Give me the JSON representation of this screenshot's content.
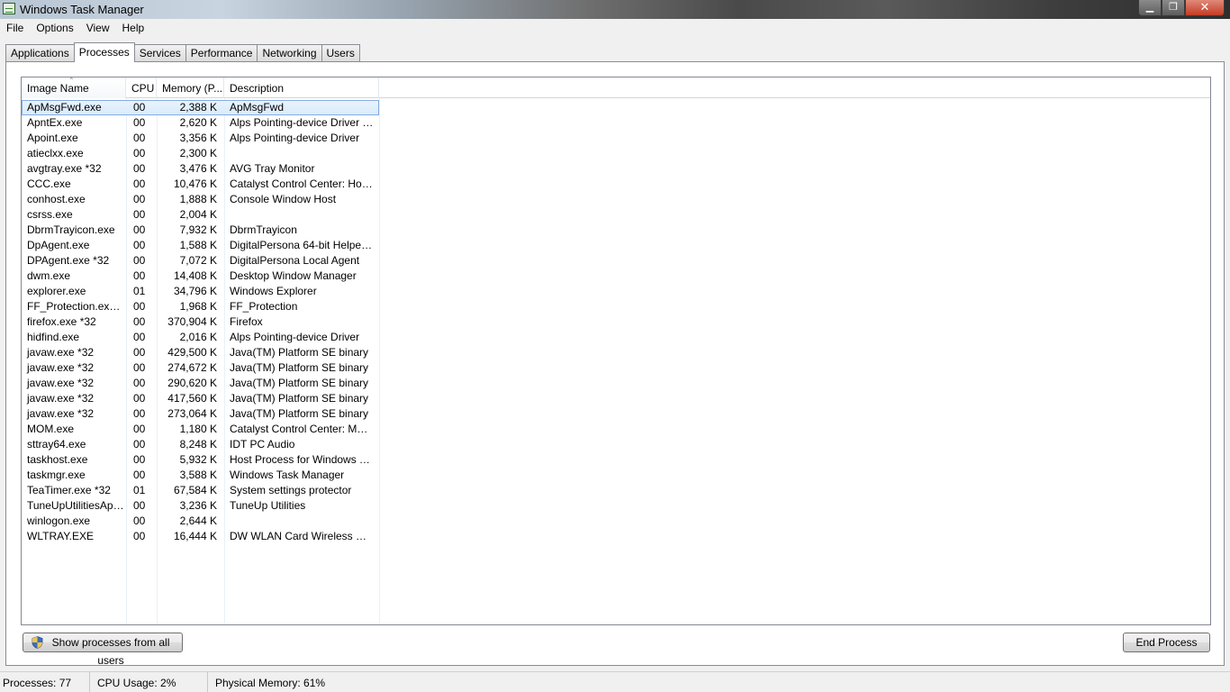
{
  "window": {
    "title": "Windows Task Manager",
    "min_glyph": "▁",
    "max_glyph": "❐",
    "close_glyph": "✕"
  },
  "menu": [
    "File",
    "Options",
    "View",
    "Help"
  ],
  "tabs": [
    "Applications",
    "Processes",
    "Services",
    "Performance",
    "Networking",
    "Users"
  ],
  "active_tab": "Processes",
  "columns": {
    "name": "Image Name",
    "cpu": "CPU",
    "memory": "Memory (P...",
    "description": "Description",
    "sort_indicator": "^"
  },
  "processes": [
    {
      "name": "ApMsgFwd.exe",
      "cpu": "00",
      "memory": "2,388 K",
      "description": "ApMsgFwd"
    },
    {
      "name": "ApntEx.exe",
      "cpu": "00",
      "memory": "2,620 K",
      "description": "Alps Pointing-device Driver for..."
    },
    {
      "name": "Apoint.exe",
      "cpu": "00",
      "memory": "3,356 K",
      "description": "Alps Pointing-device Driver"
    },
    {
      "name": "atieclxx.exe",
      "cpu": "00",
      "memory": "2,300 K",
      "description": ""
    },
    {
      "name": "avgtray.exe *32",
      "cpu": "00",
      "memory": "3,476 K",
      "description": "AVG Tray Monitor"
    },
    {
      "name": "CCC.exe",
      "cpu": "00",
      "memory": "10,476 K",
      "description": "Catalyst Control Center: Host ..."
    },
    {
      "name": "conhost.exe",
      "cpu": "00",
      "memory": "1,888 K",
      "description": "Console Window Host"
    },
    {
      "name": "csrss.exe",
      "cpu": "00",
      "memory": "2,004 K",
      "description": ""
    },
    {
      "name": "DbrmTrayicon.exe",
      "cpu": "00",
      "memory": "7,932 K",
      "description": "DbrmTrayicon"
    },
    {
      "name": "DpAgent.exe",
      "cpu": "00",
      "memory": "1,588 K",
      "description": "DigitalPersona 64-bit Helper Pr..."
    },
    {
      "name": "DPAgent.exe *32",
      "cpu": "00",
      "memory": "7,072 K",
      "description": "DigitalPersona Local Agent"
    },
    {
      "name": "dwm.exe",
      "cpu": "00",
      "memory": "14,408 K",
      "description": "Desktop Window Manager"
    },
    {
      "name": "explorer.exe",
      "cpu": "01",
      "memory": "34,796 K",
      "description": "Windows Explorer"
    },
    {
      "name": "FF_Protection.exe ...",
      "cpu": "00",
      "memory": "1,968 K",
      "description": "FF_Protection"
    },
    {
      "name": "firefox.exe *32",
      "cpu": "00",
      "memory": "370,904 K",
      "description": "Firefox"
    },
    {
      "name": "hidfind.exe",
      "cpu": "00",
      "memory": "2,016 K",
      "description": "Alps Pointing-device Driver"
    },
    {
      "name": "javaw.exe *32",
      "cpu": "00",
      "memory": "429,500 K",
      "description": "Java(TM) Platform SE binary"
    },
    {
      "name": "javaw.exe *32",
      "cpu": "00",
      "memory": "274,672 K",
      "description": "Java(TM) Platform SE binary"
    },
    {
      "name": "javaw.exe *32",
      "cpu": "00",
      "memory": "290,620 K",
      "description": "Java(TM) Platform SE binary"
    },
    {
      "name": "javaw.exe *32",
      "cpu": "00",
      "memory": "417,560 K",
      "description": "Java(TM) Platform SE binary"
    },
    {
      "name": "javaw.exe *32",
      "cpu": "00",
      "memory": "273,064 K",
      "description": "Java(TM) Platform SE binary"
    },
    {
      "name": "MOM.exe",
      "cpu": "00",
      "memory": "1,180 K",
      "description": "Catalyst Control Center: Moni..."
    },
    {
      "name": "sttray64.exe",
      "cpu": "00",
      "memory": "8,248 K",
      "description": "IDT PC Audio"
    },
    {
      "name": "taskhost.exe",
      "cpu": "00",
      "memory": "5,932 K",
      "description": "Host Process for Windows Tasks"
    },
    {
      "name": "taskmgr.exe",
      "cpu": "00",
      "memory": "3,588 K",
      "description": "Windows Task Manager"
    },
    {
      "name": "TeaTimer.exe *32",
      "cpu": "01",
      "memory": "67,584 K",
      "description": "System settings protector"
    },
    {
      "name": "TuneUpUtilitiesApp...",
      "cpu": "00",
      "memory": "3,236 K",
      "description": "TuneUp Utilities"
    },
    {
      "name": "winlogon.exe",
      "cpu": "00",
      "memory": "2,644 K",
      "description": ""
    },
    {
      "name": "WLTRAY.EXE",
      "cpu": "00",
      "memory": "16,444 K",
      "description": "DW WLAN Card Wireless Netw..."
    }
  ],
  "selected_row": 0,
  "buttons": {
    "show_all": "Show processes from all users",
    "end_process": "End Process"
  },
  "status": {
    "processes": "Processes: 77",
    "cpu": "CPU Usage: 2%",
    "memory": "Physical Memory: 61%"
  },
  "icons": {
    "app": "task-manager-icon",
    "shield": "uac-shield-icon"
  },
  "colors": {
    "selection_fill": "#d9ebfc",
    "selection_border": "#84acdd",
    "close_button": "#c23c24"
  }
}
